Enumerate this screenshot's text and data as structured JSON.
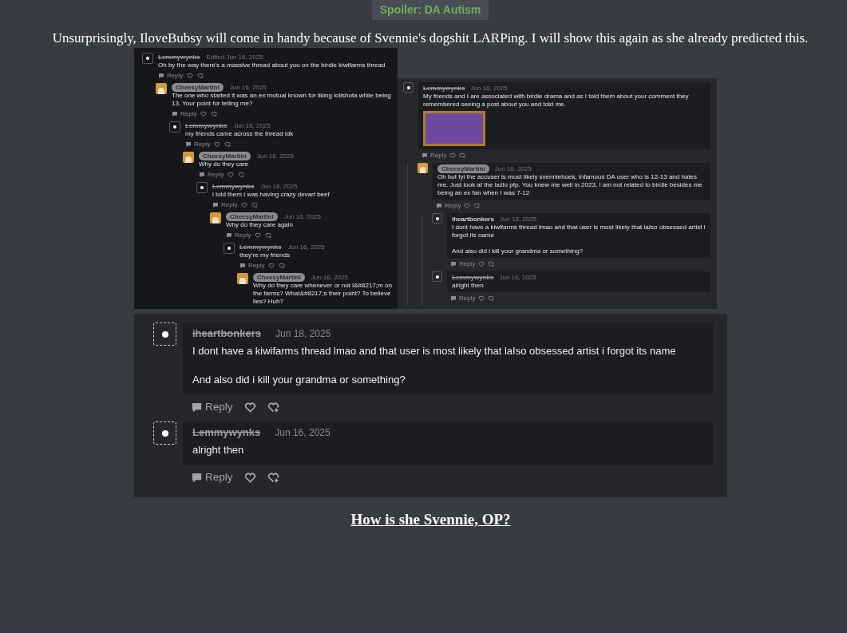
{
  "spoiler": {
    "label": "Spoiler: DA Autism"
  },
  "intro": "Unsurprisingly, IloveBubsy will come in handy because of Svennie's dogshit LARPing. I will show this again as she already predicted this.",
  "screenshots": [
    {
      "kind": "plain-small",
      "comments": [
        {
          "user": "Lemmywynks",
          "struck": true,
          "badge": false,
          "picture_avatar": false,
          "date": "Edited Jun 16, 2025",
          "text": "Oh by the way there's a massive thread about you on the birdie kiwifarms thread",
          "action_label": "Reply",
          "children": [
            {
              "user": "CheesyMartini",
              "struck": false,
              "badge": true,
              "picture_avatar": true,
              "date": "Jun 16, 2025",
              "text": "The one who started it was an ex mutual known for liking lolishota while being 13. Your point for telling me?",
              "action_label": "Reply",
              "children": [
                {
                  "user": "Lemmywynks",
                  "struck": true,
                  "badge": false,
                  "picture_avatar": false,
                  "date": "Jun 16, 2025",
                  "text": "my friends came across the thread idk",
                  "action_label": "Reply",
                  "children": [
                    {
                      "user": "CheesyMartini",
                      "struck": false,
                      "badge": true,
                      "picture_avatar": true,
                      "date": "Jun 16, 2025",
                      "text": "Why do they care",
                      "action_label": "Reply",
                      "children": [
                        {
                          "user": "Lemmywynks",
                          "struck": true,
                          "badge": false,
                          "picture_avatar": false,
                          "date": "Jun 16, 2025",
                          "text": "i told them i was having crazy devart beef",
                          "action_label": "Reply",
                          "children": [
                            {
                              "user": "CheesyMartini",
                              "struck": false,
                              "badge": true,
                              "picture_avatar": true,
                              "date": "Jun 16, 2025",
                              "text": "Why do they care again",
                              "action_label": "Reply",
                              "children": [
                                {
                                  "user": "Lemmywynks",
                                  "struck": true,
                                  "badge": false,
                                  "picture_avatar": false,
                                  "date": "Jun 16, 2025",
                                  "text": "they're my friends",
                                  "action_label": "Reply",
                                  "children": [
                                    {
                                      "user": "CheesyMartini",
                                      "struck": false,
                                      "badge": true,
                                      "picture_avatar": true,
                                      "date": "Jun 16, 2025",
                                      "text": "Why do they care whenever or not I&#8217;m on the farms? What&#8217;s their point? To believe lies? Huh?"
                                    }
                                  ]
                                }
                              ]
                            }
                          ]
                        }
                      ]
                    }
                  ]
                }
              ]
            }
          ]
        }
      ]
    },
    {
      "kind": "boxed-small",
      "comments": [
        {
          "user": "Lemmywynks",
          "struck": true,
          "badge": false,
          "picture_avatar": false,
          "date": "Jun 16, 2025",
          "text": "My friends and I are associated with birdie drama and as I told them about your comment they remembered seeing a post about you and told me.",
          "has_image": true,
          "action_label": "Reply",
          "children": [
            {
              "user": "CheesyMartini",
              "struck": false,
              "badge": true,
              "picture_avatar": true,
              "date": "Jun 16, 2025",
              "text": "Oh but fyi the accuser is most likely svenniehoek, infamous DA user who is 12-13 and hates me. Just look at the lazlo pfp. You knew me well in 2023, I am not related to birdie besides me being an ex fan when I was 7-12",
              "has_image": false,
              "action_label": "Reply",
              "children": [
                {
                  "user": "iheartbonkers",
                  "struck": false,
                  "badge": false,
                  "picture_avatar": false,
                  "date": "Jun 18, 2025",
                  "text": "I dont have a kiwifarms thread lmao and that user is most likely that laIso obsessed artist i forgot its name\n\nAnd also did i kill your grandma or something?",
                  "has_image": false,
                  "action_label": "Reply"
                },
                {
                  "user": "Lemmywynks",
                  "struck": true,
                  "badge": false,
                  "picture_avatar": false,
                  "date": "Jun 16, 2025",
                  "text": "alright then",
                  "has_image": false,
                  "action_label": "Reply"
                }
              ]
            }
          ]
        }
      ]
    },
    {
      "kind": "boxed-large",
      "comments": [
        {
          "user": "iheartbonkers",
          "struck": true,
          "badge": false,
          "picture_avatar": false,
          "date": "Jun 18, 2025",
          "text": "I dont have a kiwifarms thread lmao and that user is most likely that laIso obsessed artist i forgot its name\n\nAnd also did i kill your grandma or something?",
          "action_label": "Reply"
        },
        {
          "user": "Lemmywynks",
          "struck": true,
          "badge": false,
          "picture_avatar": false,
          "date": "Jun 16, 2025",
          "text": "alright then",
          "action_label": "Reply"
        }
      ]
    }
  ],
  "closing_link": "How is she Svennie, OP?"
}
